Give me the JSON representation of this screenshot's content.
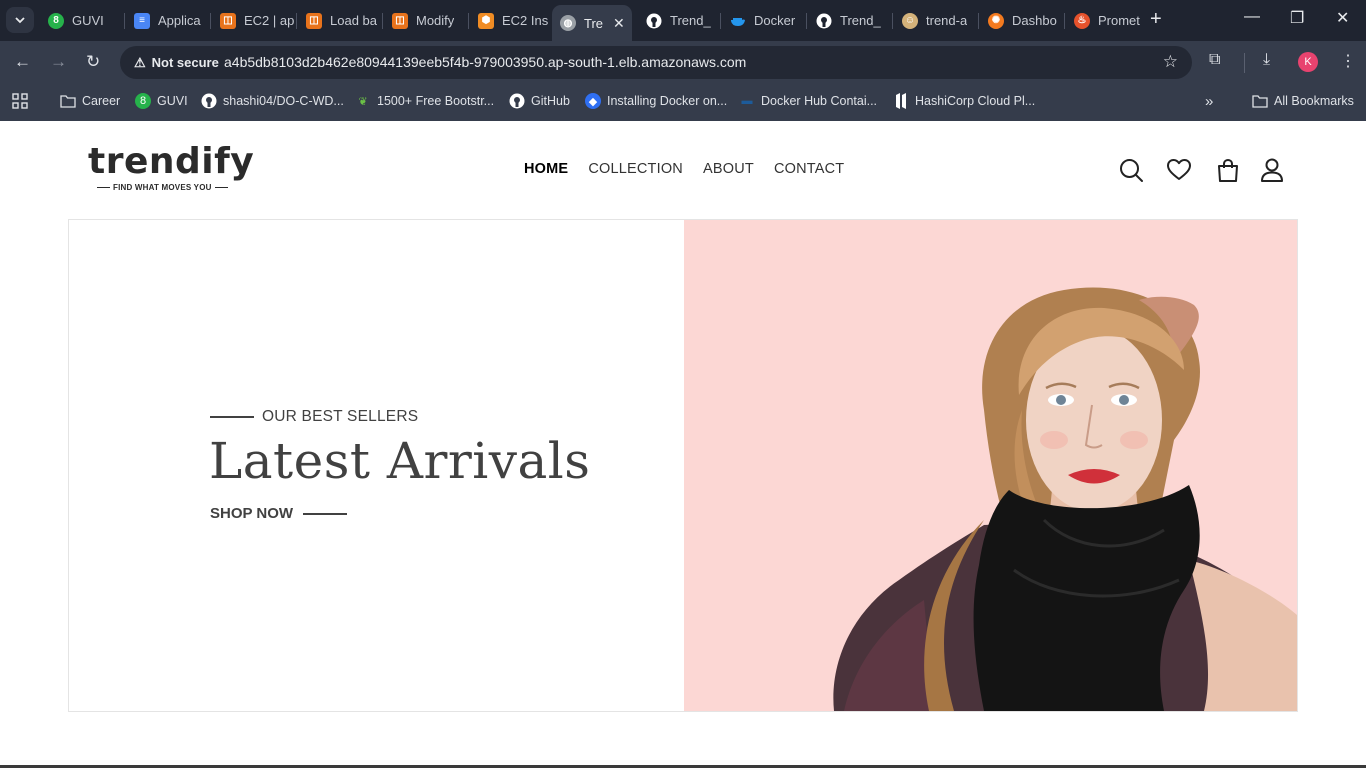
{
  "browser": {
    "tabs": [
      {
        "title": "GUVI",
        "icon": "guvi-icon",
        "color": "#26b24b"
      },
      {
        "title": "Applica",
        "icon": "docs-icon",
        "color": "#4a86f5"
      },
      {
        "title": "EC2 | ap",
        "icon": "aws-ec2-icon",
        "color": "#e8731c"
      },
      {
        "title": "Load ba",
        "icon": "aws-ec2-icon",
        "color": "#e8731c"
      },
      {
        "title": "Modify",
        "icon": "aws-ec2-icon",
        "color": "#e8731c"
      },
      {
        "title": "EC2 Ins",
        "icon": "aws-cube-icon",
        "color": "#f08c24"
      },
      {
        "title": "Tre",
        "icon": "globe-icon",
        "color": "#9aa0a6"
      },
      {
        "title": "Trend_",
        "icon": "github-icon",
        "color": "#ffffff"
      },
      {
        "title": "Docker",
        "icon": "docker-icon",
        "color": "#2496ed"
      },
      {
        "title": "Trend_",
        "icon": "github-icon",
        "color": "#ffffff"
      },
      {
        "title": "trend-a",
        "icon": "jenkins-icon",
        "color": "#d4b27a"
      },
      {
        "title": "Dashbo",
        "icon": "grafana-icon",
        "color": "#f37a1f"
      },
      {
        "title": "Promet",
        "icon": "prometheus-icon",
        "color": "#e6522c"
      }
    ],
    "active_tab_close": "✕",
    "url_chip": "Not secure",
    "url": "a4b5db8103d2b462e80944139eeb5f4b-979003950.ap-south-1.elb.amazonaws.com",
    "profile_initial": "K",
    "bookmarks": [
      {
        "label": "Career",
        "icon": "folder-icon"
      },
      {
        "label": "GUVI",
        "icon": "guvi-icon"
      },
      {
        "label": "shashi04/DO-C-WD...",
        "icon": "github-icon"
      },
      {
        "label": "1500+ Free Bootstr...",
        "icon": "leaf-icon"
      },
      {
        "label": "GitHub",
        "icon": "github-icon"
      },
      {
        "label": "Installing Docker on...",
        "icon": "diamond-icon"
      },
      {
        "label": "Docker Hub Contai...",
        "icon": "docker-icon"
      },
      {
        "label": "HashiCorp Cloud Pl...",
        "icon": "hashicorp-icon"
      }
    ],
    "all_bookmarks": "All Bookmarks"
  },
  "site": {
    "logo_word": "trendify",
    "logo_tagline": "FIND WHAT MOVES YOU",
    "nav": [
      "HOME",
      "COLLECTION",
      "ABOUT",
      "CONTACT"
    ],
    "active_nav": "HOME",
    "hero": {
      "eyebrow": "OUR BEST SELLERS",
      "headline": "Latest Arrivals",
      "cta": "SHOP NOW",
      "panel_color": "#fcd7d4"
    }
  }
}
